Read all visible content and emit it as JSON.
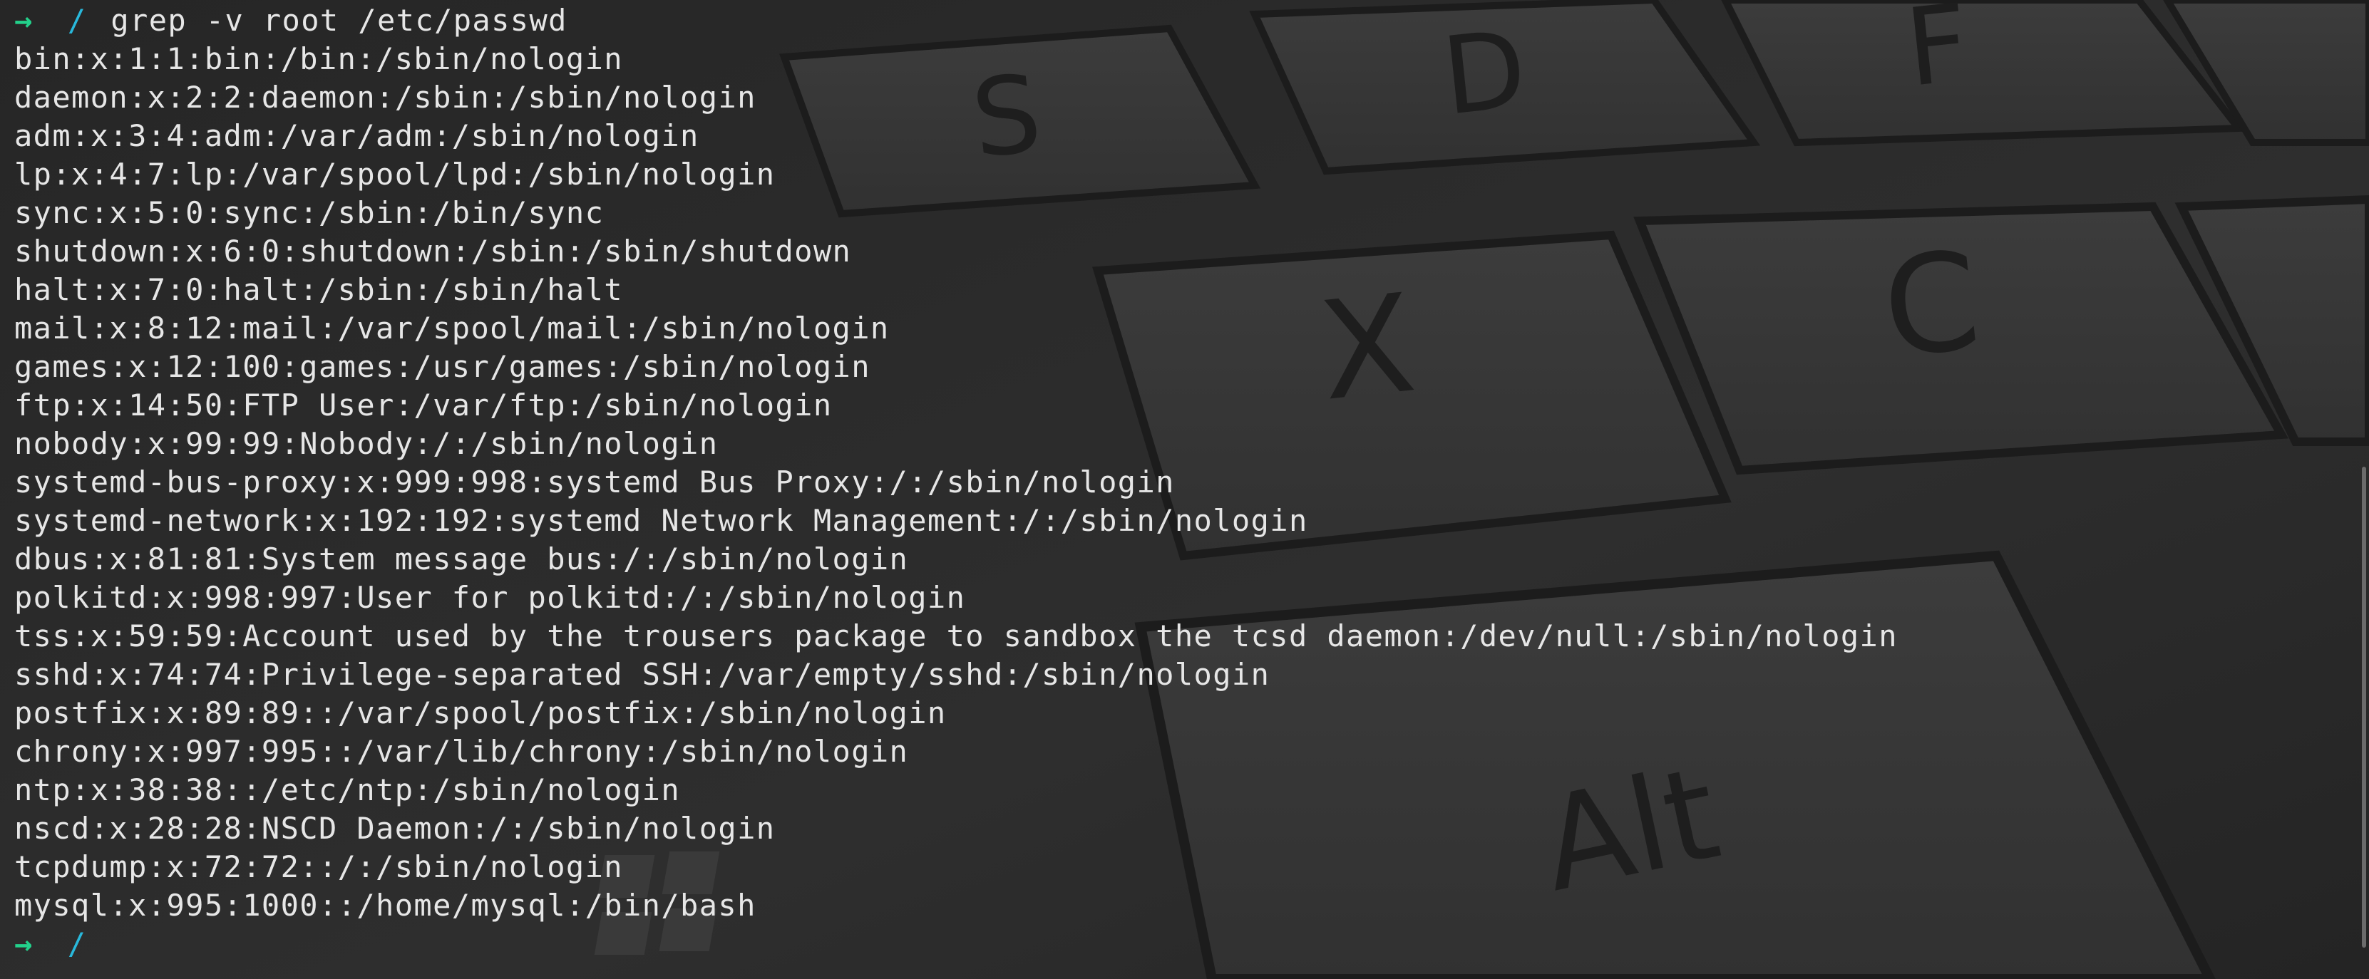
{
  "terminal": {
    "prompt_symbol": "→",
    "cwd": "/",
    "command": "grep -v root /etc/passwd",
    "output": [
      "bin:x:1:1:bin:/bin:/sbin/nologin",
      "daemon:x:2:2:daemon:/sbin:/sbin/nologin",
      "adm:x:3:4:adm:/var/adm:/sbin/nologin",
      "lp:x:4:7:lp:/var/spool/lpd:/sbin/nologin",
      "sync:x:5:0:sync:/sbin:/bin/sync",
      "shutdown:x:6:0:shutdown:/sbin:/sbin/shutdown",
      "halt:x:7:0:halt:/sbin:/sbin/halt",
      "mail:x:8:12:mail:/var/spool/mail:/sbin/nologin",
      "games:x:12:100:games:/usr/games:/sbin/nologin",
      "ftp:x:14:50:FTP User:/var/ftp:/sbin/nologin",
      "nobody:x:99:99:Nobody:/:/sbin/nologin",
      "systemd-bus-proxy:x:999:998:systemd Bus Proxy:/:/sbin/nologin",
      "systemd-network:x:192:192:systemd Network Management:/:/sbin/nologin",
      "dbus:x:81:81:System message bus:/:/sbin/nologin",
      "polkitd:x:998:997:User for polkitd:/:/sbin/nologin",
      "tss:x:59:59:Account used by the trousers package to sandbox the tcsd daemon:/dev/null:/sbin/nologin",
      "sshd:x:74:74:Privilege-separated SSH:/var/empty/sshd:/sbin/nologin",
      "postfix:x:89:89::/var/spool/postfix:/sbin/nologin",
      "chrony:x:997:995::/var/lib/chrony:/sbin/nologin",
      "ntp:x:38:38::/etc/ntp:/sbin/nologin",
      "nscd:x:28:28:NSCD Daemon:/:/sbin/nologin",
      "tcpdump:x:72:72::/:/sbin/nologin",
      "mysql:x:995:1000::/home/mysql:/bin/bash"
    ]
  },
  "wallpaper": {
    "key_labels": [
      "S",
      "D",
      "F",
      "X",
      "C",
      "Alt"
    ]
  },
  "colors": {
    "background": "#2b2b2b",
    "text": "#e6e6e6",
    "prompt_arrow": "#23d18b",
    "cwd": "#29b8db"
  }
}
